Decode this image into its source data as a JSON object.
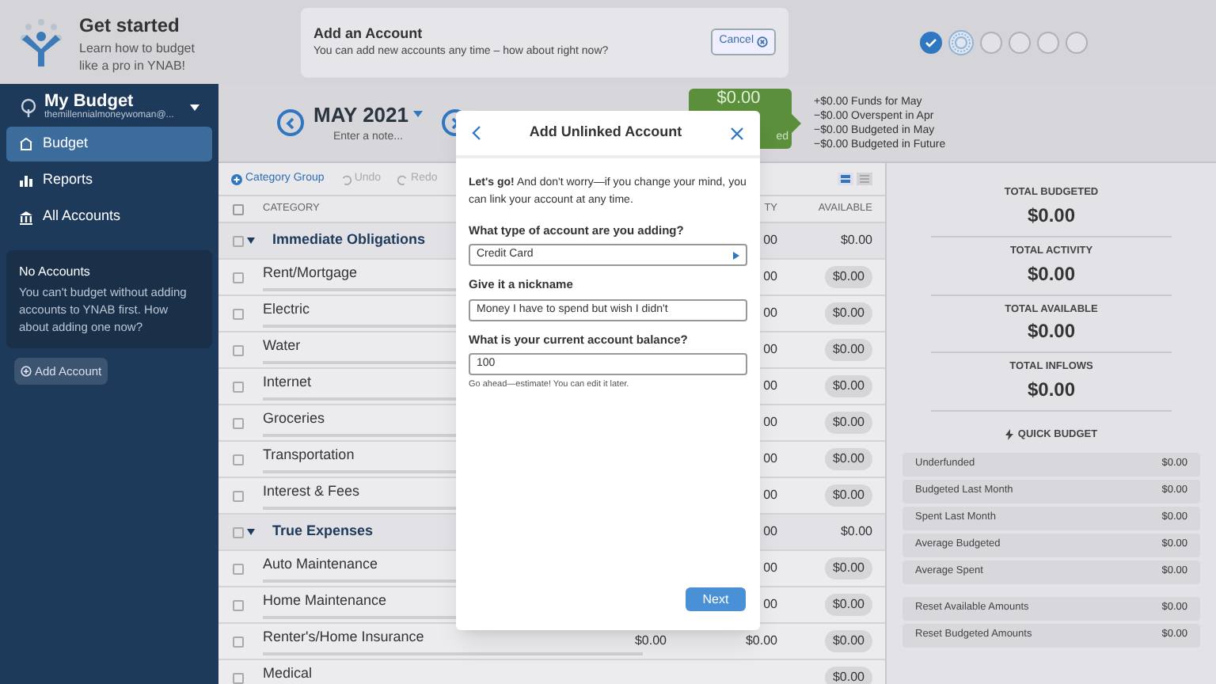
{
  "onboarding": {
    "title": "Get started",
    "subtitle": "Learn how to budget like a pro in YNAB!"
  },
  "banner": {
    "title": "Add an Account",
    "text": "You can add new accounts any time – how about right now?",
    "cancel": "Cancel"
  },
  "steps": [
    {
      "checked": true,
      "selected": false
    },
    {
      "checked": false,
      "selected": true
    },
    {
      "checked": false,
      "selected": false
    },
    {
      "checked": false,
      "selected": false
    },
    {
      "checked": false,
      "selected": false
    },
    {
      "checked": false,
      "selected": false
    }
  ],
  "sidebar": {
    "budget_name": "My Budget",
    "email": "themillennialmoneywoman@...",
    "items": [
      {
        "label": "Budget",
        "selected": true
      },
      {
        "label": "Reports",
        "selected": false
      },
      {
        "label": "All Accounts",
        "selected": false
      }
    ],
    "notice": {
      "title": "No Accounts",
      "text": "You can't budget without adding accounts to YNAB first. How about adding one now?"
    },
    "add_account": "Add Account"
  },
  "month": {
    "label": "MAY 2021",
    "note_placeholder": "Enter a note..."
  },
  "to_be_budgeted": {
    "amount": "$0.00",
    "label": "ed"
  },
  "summary": [
    "+$0.00 Funds for May",
    "−$0.00 Overspent in Apr",
    "−$0.00 Budgeted in May",
    "−$0.00 Budgeted in Future"
  ],
  "toolbar": {
    "category_group": "Category Group",
    "undo": "Undo",
    "redo": "Redo"
  },
  "table": {
    "columns": {
      "category": "CATEGORY",
      "activity": "TY",
      "available": "AVAILABLE"
    },
    "all_checked": false,
    "rows": [
      {
        "kind": "group",
        "name": "Immediate Obligations",
        "activity": "00",
        "available": "$0.00",
        "checked": false
      },
      {
        "kind": "category",
        "name": "Rent/Mortgage",
        "activity": "00",
        "available": "$0.00",
        "checked": false
      },
      {
        "kind": "category",
        "name": "Electric",
        "activity": "00",
        "available": "$0.00",
        "checked": false
      },
      {
        "kind": "category",
        "name": "Water",
        "activity": "00",
        "available": "$0.00",
        "checked": false
      },
      {
        "kind": "category",
        "name": "Internet",
        "activity": "00",
        "available": "$0.00",
        "checked": false
      },
      {
        "kind": "category",
        "name": "Groceries",
        "activity": "00",
        "available": "$0.00",
        "checked": false
      },
      {
        "kind": "category",
        "name": "Transportation",
        "activity": "00",
        "available": "$0.00",
        "checked": false
      },
      {
        "kind": "category",
        "name": "Interest & Fees",
        "activity": "00",
        "available": "$0.00",
        "checked": false
      },
      {
        "kind": "group",
        "name": "True Expenses",
        "activity": "00",
        "available": "$0.00",
        "checked": false
      },
      {
        "kind": "category",
        "name": "Auto Maintenance",
        "activity": "00",
        "available": "$0.00",
        "checked": false
      },
      {
        "kind": "category",
        "name": "Home Maintenance",
        "activity": "00",
        "available": "$0.00",
        "checked": false
      },
      {
        "kind": "category",
        "name": "Renter's/Home Insurance",
        "budgeted": "$0.00",
        "activity": "$0.00",
        "available": "$0.00",
        "checked": false
      },
      {
        "kind": "category",
        "name": "Medical",
        "available": "$0.00",
        "checked": false
      }
    ]
  },
  "totals": [
    {
      "label": "TOTAL BUDGETED",
      "amount": "$0.00"
    },
    {
      "label": "TOTAL ACTIVITY",
      "amount": "$0.00"
    },
    {
      "label": "TOTAL AVAILABLE",
      "amount": "$0.00"
    },
    {
      "label": "TOTAL INFLOWS",
      "amount": "$0.00"
    }
  ],
  "quick_budget": {
    "title": "QUICK BUDGET",
    "items": [
      {
        "label": "Underfunded",
        "amount": "$0.00"
      },
      {
        "label": "Budgeted Last Month",
        "amount": "$0.00"
      },
      {
        "label": "Spent Last Month",
        "amount": "$0.00"
      },
      {
        "label": "Average Budgeted",
        "amount": "$0.00"
      },
      {
        "label": "Average Spent",
        "amount": "$0.00"
      }
    ],
    "reset": [
      {
        "label": "Reset Available Amounts",
        "amount": "$0.00"
      },
      {
        "label": "Reset Budgeted Amounts",
        "amount": "$0.00"
      }
    ]
  },
  "modal": {
    "title": "Add Unlinked Account",
    "intro": "**Let's go!** And don't worry—if you change your mind, you can link your account at any time.",
    "fields": [
      {
        "kind": "select",
        "label": "What type of account are you adding?",
        "value": "Credit Card"
      },
      {
        "kind": "text",
        "label": "Give it a nickname",
        "value": "Money I have to spend but wish I didn't"
      },
      {
        "kind": "text",
        "label": "What is your current account balance?",
        "value": "100",
        "hint": "Go ahead—estimate! You can edit it later."
      }
    ],
    "next": "Next"
  }
}
